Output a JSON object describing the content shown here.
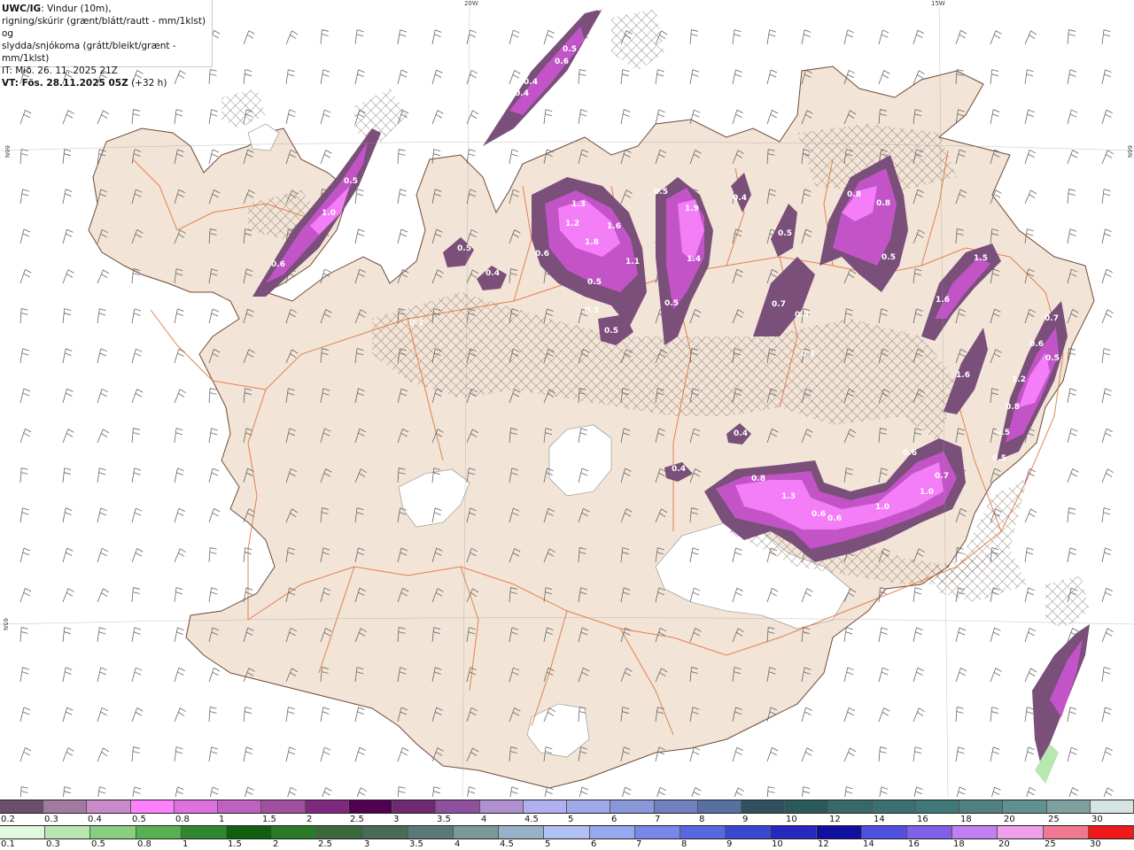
{
  "header": {
    "line1_bold": "UWC/IG",
    "line1_rest": ": Vindur (10m),",
    "line2": "rigning/skúrir (grænt/blátt/rautt - mm/1klst) og",
    "line3": "slydda/snjókoma (grátt/bleikt/grænt - mm/1klst)",
    "line4": "IT: Mið. 26. 11. 2025 21Z",
    "line5_bold": "VT: Fös. 28.11.2025 05Z",
    "line5_rest": " (+32 h)"
  },
  "grid_labels": {
    "lon_20w": "20W",
    "lon_15w": "15W",
    "lat_66n_left": "66N",
    "lat_66n_right": "66N",
    "lat_65n_left": "65N"
  },
  "precip_labels": [
    "0.5",
    "0.5",
    "0.6",
    "0.4",
    "0.4",
    "0.5",
    "1.0",
    "0.6",
    "0.5",
    "0.4",
    "1.3",
    "1.2",
    "1.8",
    "1.6",
    "0.6",
    "1.1",
    "0.5",
    "0.3",
    "0.5",
    "0.5",
    "1.9",
    "1.4",
    "0.5",
    "0.4",
    "0.5",
    "0.7",
    "0.4",
    "0.8",
    "0.8",
    "0.5",
    "1.5",
    "1.6",
    "0.7",
    "0.6",
    "0.5",
    "1.2",
    "0.8",
    "0.5",
    "0.5",
    "1.6",
    "0.3",
    "0.4",
    "0.4",
    "0.8",
    "1.3",
    "0.6",
    "0.6",
    "1.0",
    "1.0",
    "0.7",
    "0.6",
    "0.3"
  ],
  "legend": {
    "snow_labels": [
      "0.2",
      "0.3",
      "0.4",
      "0.5",
      "0.8",
      "1",
      "1.5",
      "2",
      "2.5",
      "3",
      "3.5",
      "4",
      "4.5",
      "5",
      "6",
      "7",
      "8",
      "9",
      "10",
      "12",
      "14",
      "16",
      "18",
      "20",
      "25",
      "30"
    ],
    "snow_colors": [
      "#6b4e6b",
      "#a07aa0",
      "#c88ac8",
      "#ff80ff",
      "#e070e0",
      "#c060c0",
      "#a050a0",
      "#802880",
      "#500050",
      "#702870",
      "#9050a0",
      "#b090d0",
      "#b0b0f0",
      "#a0a8e8",
      "#8898d8",
      "#7080c0",
      "#5870a0",
      "#305060",
      "#2a5a5a",
      "#386868",
      "#3c7070",
      "#407878",
      "#508080",
      "#609090",
      "#80a0a0",
      "#d8e4e4"
    ],
    "rain_labels": [
      "0.1",
      "0.3",
      "0.5",
      "0.8",
      "1",
      "1.5",
      "2",
      "2.5",
      "3",
      "3.5",
      "4",
      "4.5",
      "5",
      "6",
      "7",
      "8",
      "9",
      "10",
      "12",
      "14",
      "16",
      "18",
      "20",
      "25",
      "30"
    ],
    "rain_colors": [
      "#e0f8e0",
      "#b8e8b0",
      "#88d080",
      "#58b050",
      "#308830",
      "#106010",
      "#2a7a2a",
      "#3a6a3a",
      "#4a6a5a",
      "#5a7a7a",
      "#7a9a9a",
      "#9ab0c8",
      "#b0c0f0",
      "#98a8f0",
      "#7888e8",
      "#5868e0",
      "#3848d0",
      "#2828c0",
      "#1010a0",
      "#5050e0",
      "#8060e8",
      "#c080f0",
      "#f0a0e8",
      "#f07890",
      "#f01818"
    ]
  },
  "colors": {
    "land": "#f2e4d6",
    "sea": "#ffffff",
    "roads": "#e0703a",
    "coast": "#6e4a3a",
    "precip_light": "#7a4f7a",
    "precip_mid": "#c254c8",
    "precip_heavy": "#f47ef7"
  }
}
